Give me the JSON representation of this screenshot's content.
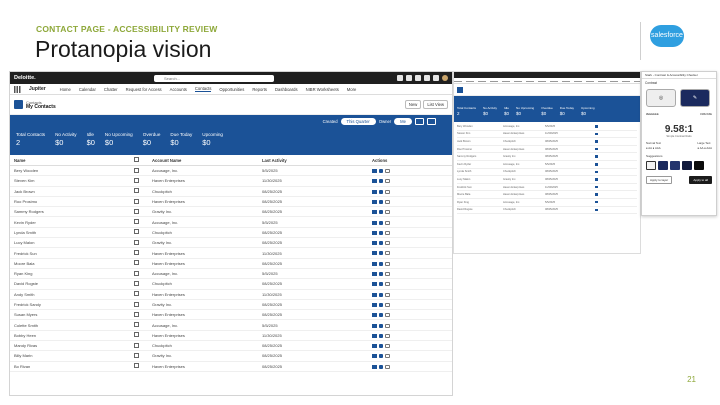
{
  "slide": {
    "eyebrow": "CONTACT PAGE - ACCESSIBILITY REVIEW",
    "title": "Protanopia vision",
    "page_number": "21",
    "logo_text": "salesforce"
  },
  "app": {
    "brand": "Deloitte.",
    "search_placeholder": "Search...",
    "app_name": "Jupiter",
    "nav": [
      "Home",
      "Calendar",
      "Chatter",
      "Request for Access",
      "Accounts",
      "Contacts",
      "Opportunities",
      "Reports",
      "Dashboards",
      "NIBR Worksheets",
      "More"
    ],
    "list_object": "Contacts",
    "list_view": "My Contacts",
    "buttons": [
      "New",
      "List View"
    ],
    "filter_label": "Created",
    "filter_value": "This Quarter",
    "owner_label": "Owner",
    "owner_value": "Me",
    "metrics": [
      {
        "label": "Total Contacts",
        "value": "2"
      },
      {
        "label": "No Activity",
        "value": "$0"
      },
      {
        "label": "Idle",
        "value": "$0"
      },
      {
        "label": "No Upcoming",
        "value": "$0"
      },
      {
        "label": "Overdue",
        "value": "$0"
      },
      {
        "label": "Due Today",
        "value": "$0"
      },
      {
        "label": "Upcoming",
        "value": "$0"
      }
    ],
    "columns": [
      "Name",
      "Account Name",
      "Last Activity",
      "Actions"
    ],
    "rows": [
      {
        "name": "Bery Wooden",
        "account": "Accusage, Inc.",
        "date": "5/5/2025"
      },
      {
        "name": "Steven Kim",
        "account": "Haven Enterprises",
        "date": "11/30/2025"
      },
      {
        "name": "Jack Brown",
        "account": "Chuckpitch",
        "date": "08/25/2025"
      },
      {
        "name": "Roo Prosimo",
        "account": "Haven Enterprises",
        "date": "08/25/2025"
      },
      {
        "name": "Sammy Rodgers",
        "account": "Gravity Inc.",
        "date": "08/25/2025"
      },
      {
        "name": "Kevin Ryder",
        "account": "Accusage, Inc.",
        "date": "5/5/2025"
      },
      {
        "name": "Lynda Smith",
        "account": "Chuckpitch",
        "date": "08/25/2025"
      },
      {
        "name": "Lucy Malon",
        "account": "Gravity Inc.",
        "date": "08/25/2025"
      },
      {
        "name": "Fredrick Sun",
        "account": "Haven Enterprises",
        "date": "11/30/2025"
      },
      {
        "name": "Moore Bala",
        "account": "Haven Enterprises",
        "date": "08/25/2025"
      },
      {
        "name": "Ryan King",
        "account": "Accusage, Inc.",
        "date": "5/5/2025"
      },
      {
        "name": "David Rogste",
        "account": "Chuckpitch",
        "date": "08/25/2025"
      },
      {
        "name": "Andy Smith",
        "account": "Haven Enterprises",
        "date": "11/30/2025"
      },
      {
        "name": "Fredrick Sandy",
        "account": "Gravity Inc.",
        "date": "08/25/2025"
      },
      {
        "name": "Susan Myers",
        "account": "Haven Enterprises",
        "date": "08/25/2025"
      },
      {
        "name": "Colette Smith",
        "account": "Accusage, Inc.",
        "date": "5/5/2025"
      },
      {
        "name": "Bobby Heen",
        "account": "Haven Enterprises",
        "date": "11/30/2025"
      },
      {
        "name": "Mandy Rivas",
        "account": "Chuckpitch",
        "date": "08/25/2025"
      },
      {
        "name": "Billy Marin",
        "account": "Gravity Inc.",
        "date": "08/25/2025"
      },
      {
        "name": "Bo Rivan",
        "account": "Haven Enterprises",
        "date": "08/25/2025"
      }
    ]
  },
  "panel": {
    "title": "Stark - Contrast & Accessibility Checker",
    "section": "Contrast",
    "swatch_a_label": "#EEEEEE",
    "swatch_b_label": "#1B2A5E",
    "ratio": "9.58:1",
    "ratio_note": "Simple Contrast Ratio",
    "normal_text": "Normal Text",
    "large_text": "Large Text",
    "suggestions": "Suggestions",
    "apply_layer": "Apply to layer",
    "apply_all": "Apply to all"
  },
  "colors": {
    "accent": "#8EA83A",
    "brand_blue": "#1B5297",
    "topbar": "#1F1F1F"
  }
}
